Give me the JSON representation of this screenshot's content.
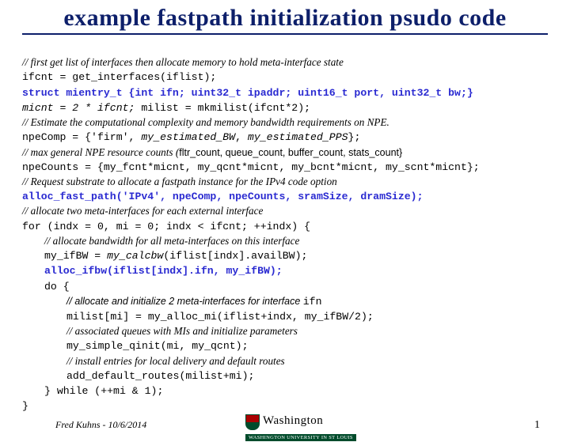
{
  "title": "example fastpath initialization psudo code",
  "lines": {
    "c1": "// first get list of interfaces then allocate memory to hold meta-interface state",
    "l1": "ifcnt = get_interfaces(iflist);",
    "l2": "struct mientry_t {int ifn; uint32_t ipaddr; uint16_t port, uint32_t bw;}",
    "l3a": "micnt = 2 * ifcnt;",
    "l3b": " milist = mkmilist(ifcnt*2);",
    "c2": "// Estimate the computational complexity and memory bandwidth requirements on NPE.",
    "l4a": "npeComp = {'firm', ",
    "l4b": "my_estimated_BW",
    "l4c": ", ",
    "l4d": "my_estimated_PPS",
    "l4e": "};",
    "c3a": "// max general NPE resource counts (",
    "c3b": "fltr_count, queue_count, buffer_count, stats_count}",
    "l5": "npeCounts = {my_fcnt*micnt, my_qcnt*micnt, my_bcnt*micnt, my_scnt*micnt};",
    "c4": "// Request substrate to allocate a fastpath instance for the IPv4 code option",
    "l6": "alloc_fast_path('IPv4', npeComp, npeCounts, sramSize, dramSize);",
    "c5": "// allocate two meta-interfaces for each external interface",
    "l7": "for (indx = 0, mi = 0; indx < ifcnt; ++indx) {",
    "c6": "// allocate bandwidth for all meta-interfaces on this interface",
    "l8a": "my_ifBW = ",
    "l8b": "my_calcbw",
    "l8c": "(iflist[indx].availBW);",
    "l9": "alloc_ifbw(iflist[indx].ifn, my_ifBW);",
    "l10": "do {",
    "c7a": "// allocate and initialize 2 meta-interfaces for interface ",
    "c7b": "ifn",
    "l11": "milist[mi] = my_alloc_mi(iflist+indx, my_ifBW/2);",
    "c8": "// associated queues with MIs and initialize parameters",
    "l12": "my_simple_qinit(mi, my_qcnt);",
    "c9": "// install entries for local delivery and default routes",
    "l13": "add_default_routes(milist+mi);",
    "l14": "} while (++mi & 1);",
    "l15": "}"
  },
  "footer": {
    "author": "Fred Kuhns - 10/6/2014",
    "university": "Washington",
    "subline": "WASHINGTON UNIVERSITY IN ST LOUIS",
    "page": "1"
  }
}
